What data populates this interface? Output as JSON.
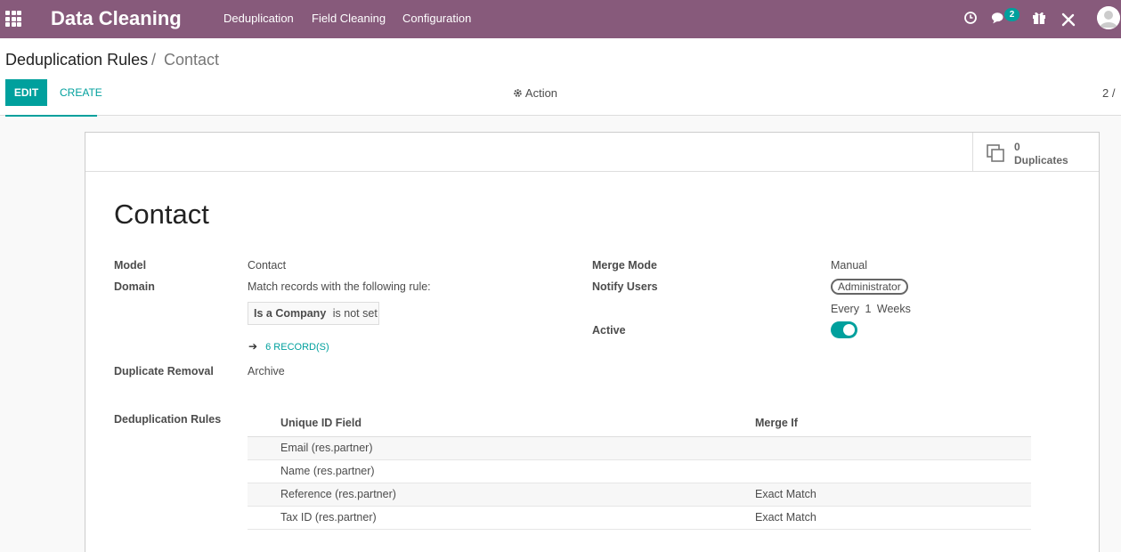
{
  "navbar": {
    "app_title": "Data Cleaning",
    "menu": [
      "Deduplication",
      "Field Cleaning",
      "Configuration"
    ],
    "messages_badge": "2",
    "icons": [
      "apps-icon",
      "clock-icon",
      "chat-icon",
      "gift-icon",
      "tools-icon",
      "avatar"
    ]
  },
  "control_panel": {
    "breadcrumb": {
      "parent": "Deduplication Rules",
      "separator": "/",
      "current": "Contact"
    },
    "edit_label": "EDIT",
    "create_label": "CREATE",
    "action_label": "Action",
    "pager": "2 /"
  },
  "smart_button": {
    "value": "0",
    "label": "Duplicates"
  },
  "form": {
    "title": "Contact",
    "model_label": "Model",
    "model_value": "Contact",
    "domain_label": "Domain",
    "domain_text": "Match records with the following rule:",
    "domain_rule": {
      "field": "Is a Company",
      "condition": "is not set"
    },
    "records_link": "6 RECORD(S)",
    "removal_label": "Duplicate Removal",
    "removal_value": "Archive",
    "merge_mode_label": "Merge Mode",
    "merge_mode_value": "Manual",
    "notify_label": "Notify Users",
    "notify_tag": "Administrator",
    "every_text": "Every",
    "every_count": "1",
    "every_unit": "Weeks",
    "active_label": "Active",
    "active": true,
    "rules_label": "Deduplication Rules"
  },
  "rules_table": {
    "headers": [
      "Unique ID Field",
      "Merge If"
    ],
    "rows": [
      {
        "field": "Email (res.partner)",
        "merge_if": ""
      },
      {
        "field": "Name (res.partner)",
        "merge_if": ""
      },
      {
        "field": "Reference (res.partner)",
        "merge_if": "Exact Match"
      },
      {
        "field": "Tax ID (res.partner)",
        "merge_if": "Exact Match"
      }
    ]
  },
  "colors": {
    "navbar": "#875a7b",
    "accent": "#00a09d"
  }
}
